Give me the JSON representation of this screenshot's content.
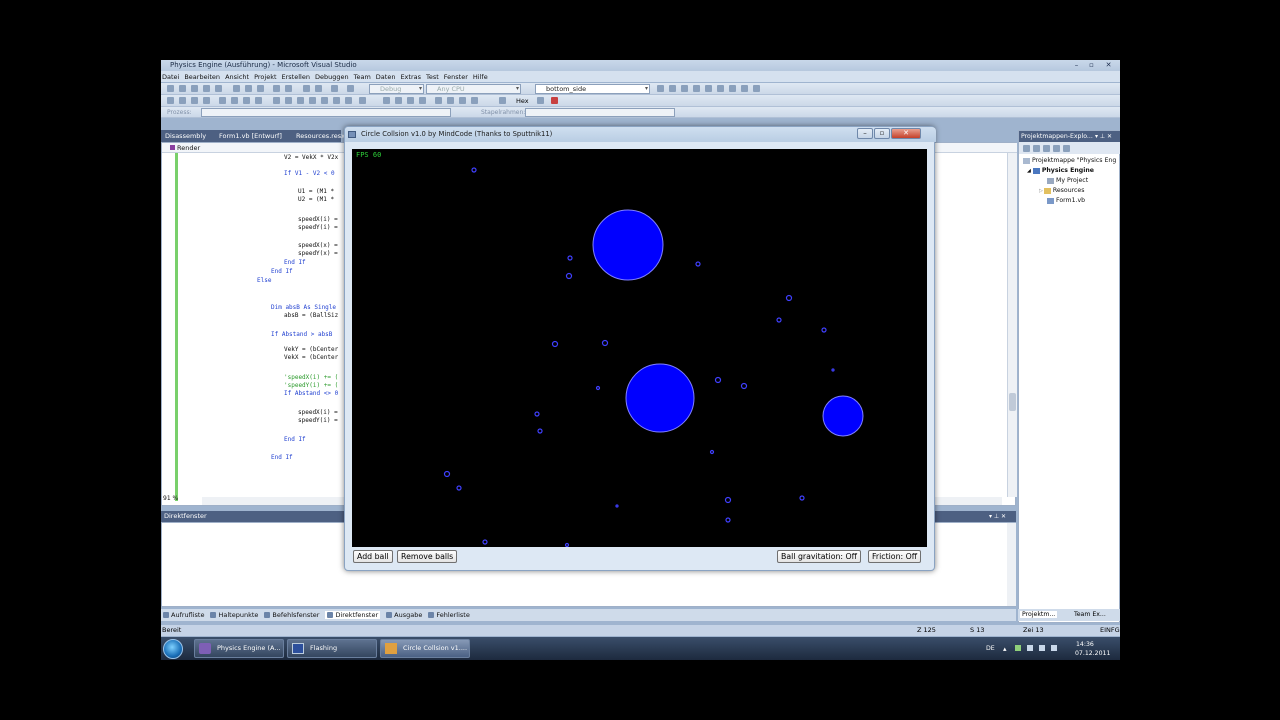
{
  "vs": {
    "title": "Physics Engine (Ausführung) - Microsoft Visual Studio",
    "menu": [
      "Datei",
      "Bearbeiten",
      "Ansicht",
      "Projekt",
      "Erstellen",
      "Debuggen",
      "Team",
      "Daten",
      "Extras",
      "Test",
      "Fenster",
      "Hilfe"
    ],
    "config": "Debug",
    "platform": "Any CPU",
    "find_combo": "bottom_side",
    "hex_label": "Hex",
    "process_label": "Prozess:",
    "stack_label": "Stapelrahmen:",
    "doc_tabs": [
      "Disassembly",
      "Form1.vb [Entwurf]",
      "Resources.resx"
    ],
    "nav_member": "Render",
    "zoom": "91 %",
    "code_lines": [
      {
        "indent": 2,
        "text": "V2 = VekX * V2x",
        "kind": "code"
      },
      {
        "indent": 2,
        "text": "If V1 - V2 < 0",
        "kind": "kw"
      },
      {
        "indent": 3,
        "text": "U1 = (M1 *",
        "kind": "code"
      },
      {
        "indent": 3,
        "text": "U2 = (M1 *",
        "kind": "code"
      },
      {
        "indent": 3,
        "text": "speedX(i) =",
        "kind": "code"
      },
      {
        "indent": 3,
        "text": "speedY(i) =",
        "kind": "code"
      },
      {
        "indent": 3,
        "text": "speedX(x) =",
        "kind": "code"
      },
      {
        "indent": 3,
        "text": "speedY(x) =",
        "kind": "code"
      },
      {
        "indent": 2,
        "text": "End If",
        "kind": "kw"
      },
      {
        "indent": 1,
        "text": "End If",
        "kind": "kw"
      },
      {
        "indent": 0,
        "text": "Else",
        "kind": "kw"
      },
      {
        "indent": 1,
        "text": "Dim absB As Single",
        "kind": "kw"
      },
      {
        "indent": 2,
        "text": "absB = (BallSiz",
        "kind": "code"
      },
      {
        "indent": 1,
        "text": "If Abstand > absB",
        "kind": "kw"
      },
      {
        "indent": 2,
        "text": "VekY = (bCenter",
        "kind": "code"
      },
      {
        "indent": 2,
        "text": "VekX = (bCenter",
        "kind": "code"
      },
      {
        "indent": 2,
        "text": "'speedX(i) += (",
        "kind": "cm"
      },
      {
        "indent": 2,
        "text": "'speedY(i) += (",
        "kind": "cm"
      },
      {
        "indent": 2,
        "text": "If Abstand <> 0",
        "kind": "kw"
      },
      {
        "indent": 3,
        "text": "speedX(i) =",
        "kind": "code"
      },
      {
        "indent": 3,
        "text": "speedY(i) =",
        "kind": "code"
      },
      {
        "indent": 2,
        "text": "End If",
        "kind": "kw"
      },
      {
        "indent": 1,
        "text": "End If",
        "kind": "kw"
      }
    ],
    "direkt_title": "Direktfenster",
    "bottom_tabs": [
      "Aufrufliste",
      "Haltepunkte",
      "Befehlsfenster",
      "Direktfenster",
      "Ausgabe",
      "Fehlerliste"
    ],
    "status": {
      "left": "Bereit",
      "line": "Z 125",
      "col": "S 13",
      "char": "Zei 13",
      "mode": "EINFG"
    },
    "solution_explorer": {
      "title": "Projektmappen-Explo...",
      "items": [
        "Projektmappe \"Physics Eng",
        "Physics Engine",
        "My Project",
        "Resources",
        "Form1.vb"
      ],
      "tabs": [
        "Projektm...",
        "Team Ex..."
      ]
    }
  },
  "taskbar": {
    "items": [
      "Physics Engine (A...",
      "Flashing",
      "Circle Collsion v1...."
    ],
    "lang": "DE",
    "time": "14:36",
    "date": "07.12.2011"
  },
  "physics_window": {
    "title": "Circle Collsion v1.0 by MindCode (Thanks to Sputtnik11)",
    "fps_text": "FPS 60",
    "buttons": {
      "add": "Add ball",
      "remove": "Remove balls",
      "gravitation": "Ball gravitation: Off",
      "friction": "Friction: Off"
    },
    "ball_color": "#0000ff",
    "ball_outline": "#8080ff"
  }
}
